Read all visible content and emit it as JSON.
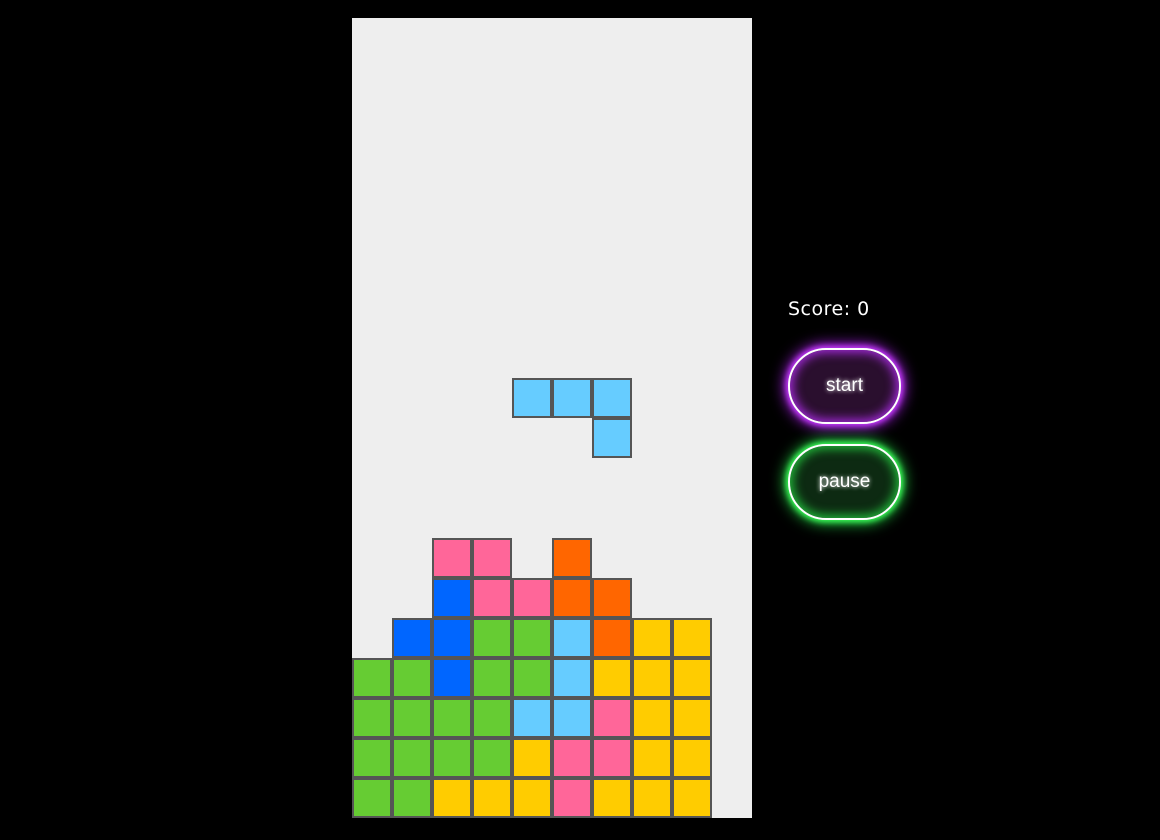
{
  "board": {
    "cols": 10,
    "rows": 20,
    "background": "#eeeeee",
    "colors": {
      "cyan": "#66ccff",
      "pink": "#ff6699",
      "orange": "#ff6600",
      "blue": "#0066ff",
      "green": "#66cc33",
      "yellow": "#ffcc00"
    },
    "active_piece": {
      "color": "cyan",
      "cells": [
        [
          4,
          9
        ],
        [
          5,
          9
        ],
        [
          6,
          9
        ],
        [
          6,
          10
        ]
      ]
    },
    "settled_rows": [
      {
        "row": 13,
        "cells": [
          null,
          null,
          "pink",
          "pink",
          null,
          "orange",
          null,
          null,
          null,
          null
        ]
      },
      {
        "row": 14,
        "cells": [
          null,
          null,
          "blue",
          "pink",
          "pink",
          "orange",
          "orange",
          null,
          null,
          null
        ]
      },
      {
        "row": 15,
        "cells": [
          null,
          "blue",
          "blue",
          "green",
          "green",
          "cyan",
          "orange",
          "yellow",
          "yellow",
          null
        ]
      },
      {
        "row": 16,
        "cells": [
          "green",
          "green",
          "blue",
          "green",
          "green",
          "cyan",
          "yellow",
          "yellow",
          "yellow",
          null
        ]
      },
      {
        "row": 17,
        "cells": [
          "green",
          "green",
          "green",
          "green",
          "cyan",
          "cyan",
          "pink",
          "yellow",
          "yellow",
          null
        ]
      },
      {
        "row": 18,
        "cells": [
          "green",
          "green",
          "green",
          "green",
          "yellow",
          "pink",
          "pink",
          "yellow",
          "yellow",
          null
        ]
      },
      {
        "row": 19,
        "cells": [
          "green",
          "green",
          "yellow",
          "yellow",
          "yellow",
          "pink",
          "yellow",
          "yellow",
          "yellow",
          null
        ]
      }
    ]
  },
  "score_text": "Score: 0",
  "controls": {
    "start_label": "start",
    "pause_label": "pause"
  }
}
